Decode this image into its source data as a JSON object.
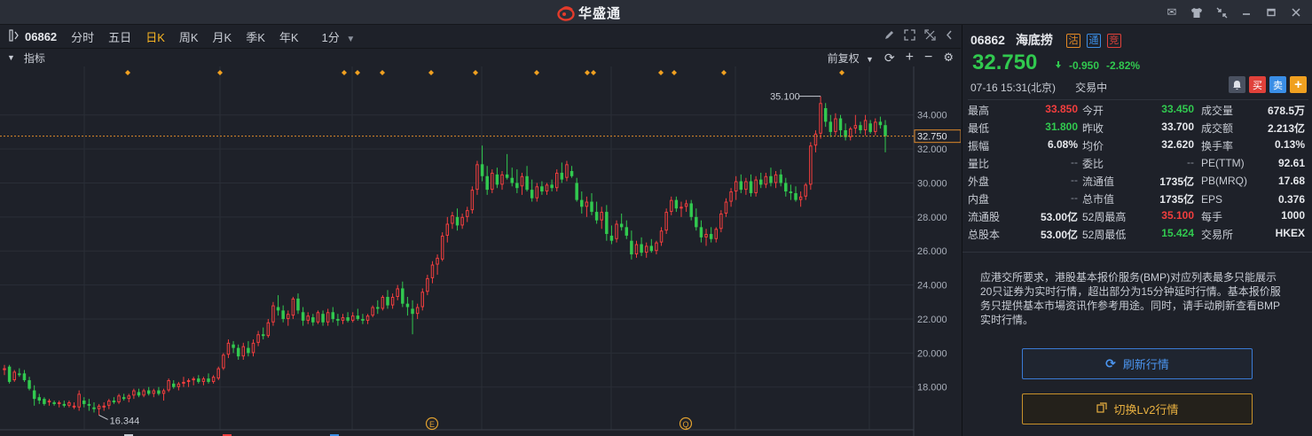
{
  "app": {
    "brand": "华盛通",
    "brand_color": "#e33b2b",
    "window_icons": [
      "mail-icon",
      "shirt-icon",
      "shrink-icon",
      "minimize-icon",
      "maximize-icon",
      "close-icon"
    ]
  },
  "toolbar": {
    "code": "06862",
    "periods": [
      "分时",
      "五日",
      "日K",
      "周K",
      "月K",
      "季K",
      "年K"
    ],
    "active_period": "日K",
    "minute_select": "1分"
  },
  "subbar": {
    "indicator_label": "指标",
    "adjust_label": "前复权"
  },
  "chart_data": {
    "type": "candlestick",
    "y_axis_ticks": [
      "34.000",
      "32.000",
      "30.000",
      "28.000",
      "26.000",
      "24.000",
      "22.000",
      "20.000",
      "18.000"
    ],
    "ylim": [
      15.9,
      35.6
    ],
    "current_price_label": "32.750",
    "current_price": 32.75,
    "high_marker": {
      "label": "35.100",
      "value": 35.1
    },
    "low_marker": {
      "label": "16.344",
      "value": 16.344
    },
    "event_markers": [
      "E",
      "Q"
    ],
    "candles": [
      [
        19.0,
        19.3,
        18.7,
        19.1
      ],
      [
        19.2,
        19.3,
        18.2,
        18.3
      ],
      [
        18.4,
        19.0,
        18.3,
        18.9
      ],
      [
        18.8,
        19.1,
        18.6,
        18.7
      ],
      [
        18.8,
        19.0,
        18.3,
        18.4
      ],
      [
        18.4,
        18.6,
        17.8,
        17.9
      ],
      [
        17.8,
        18.1,
        16.9,
        17.3
      ],
      [
        17.4,
        17.6,
        17.0,
        17.2
      ],
      [
        17.3,
        17.4,
        16.9,
        17.0
      ],
      [
        17.1,
        17.3,
        16.9,
        17.2
      ],
      [
        17.1,
        17.2,
        16.9,
        17.0
      ],
      [
        17.0,
        17.2,
        16.8,
        17.1
      ],
      [
        17.0,
        17.2,
        16.8,
        16.9
      ],
      [
        16.9,
        17.2,
        16.8,
        17.1
      ],
      [
        16.9,
        17.1,
        16.7,
        16.9
      ],
      [
        16.8,
        17.8,
        16.6,
        17.6
      ],
      [
        17.2,
        17.4,
        16.8,
        17.0
      ],
      [
        17.0,
        17.3,
        16.6,
        16.9
      ],
      [
        16.8,
        17.1,
        16.5,
        16.7
      ],
      [
        16.7,
        17.0,
        16.344,
        16.9
      ],
      [
        16.8,
        17.1,
        16.6,
        16.9
      ],
      [
        16.9,
        17.3,
        16.7,
        17.2
      ],
      [
        17.2,
        17.4,
        17.0,
        17.1
      ],
      [
        17.1,
        17.6,
        17.0,
        17.5
      ],
      [
        17.4,
        17.6,
        17.2,
        17.3
      ],
      [
        17.3,
        17.6,
        17.1,
        17.5
      ],
      [
        17.5,
        17.9,
        17.3,
        17.8
      ],
      [
        17.7,
        17.9,
        17.4,
        17.5
      ],
      [
        17.5,
        17.9,
        17.4,
        17.8
      ],
      [
        17.8,
        18.0,
        17.5,
        17.6
      ],
      [
        17.6,
        17.9,
        17.4,
        17.8
      ],
      [
        17.8,
        18.0,
        17.5,
        17.6
      ],
      [
        17.6,
        17.9,
        17.2,
        17.8
      ],
      [
        17.8,
        18.5,
        17.7,
        18.4
      ],
      [
        18.2,
        18.4,
        17.9,
        18.0
      ],
      [
        18.0,
        18.3,
        17.8,
        18.2
      ],
      [
        18.2,
        18.6,
        18.0,
        18.3
      ],
      [
        18.3,
        18.5,
        18.0,
        18.4
      ],
      [
        18.4,
        18.6,
        18.1,
        18.5
      ],
      [
        18.5,
        18.7,
        18.2,
        18.3
      ],
      [
        18.3,
        18.6,
        18.1,
        18.5
      ],
      [
        18.5,
        18.8,
        18.2,
        18.3
      ],
      [
        18.3,
        18.7,
        18.2,
        18.6
      ],
      [
        18.5,
        19.2,
        18.4,
        19.1
      ],
      [
        19.1,
        20.0,
        19.0,
        19.9
      ],
      [
        19.9,
        20.8,
        19.7,
        20.6
      ],
      [
        20.5,
        20.7,
        20.0,
        20.3
      ],
      [
        20.3,
        20.5,
        19.6,
        19.8
      ],
      [
        19.8,
        20.6,
        19.6,
        20.4
      ],
      [
        20.3,
        20.7,
        19.8,
        20.0
      ],
      [
        20.0,
        20.8,
        19.8,
        20.6
      ],
      [
        20.6,
        21.3,
        20.4,
        21.1
      ],
      [
        21.1,
        21.5,
        20.8,
        21.0
      ],
      [
        21.0,
        22.0,
        20.9,
        21.8
      ],
      [
        21.8,
        23.0,
        21.6,
        22.8
      ],
      [
        22.7,
        23.4,
        22.2,
        22.5
      ],
      [
        22.5,
        22.8,
        21.8,
        22.0
      ],
      [
        22.0,
        22.5,
        21.6,
        22.3
      ],
      [
        22.2,
        23.3,
        22.0,
        23.2
      ],
      [
        23.2,
        23.5,
        22.3,
        22.5
      ],
      [
        22.4,
        22.7,
        21.6,
        21.9
      ],
      [
        21.9,
        22.4,
        21.7,
        22.2
      ],
      [
        22.1,
        22.3,
        21.6,
        21.8
      ],
      [
        21.8,
        22.5,
        21.7,
        22.4
      ],
      [
        22.3,
        22.5,
        21.6,
        21.8
      ],
      [
        21.8,
        22.6,
        21.6,
        22.4
      ],
      [
        22.4,
        22.7,
        21.8,
        22.0
      ],
      [
        22.0,
        22.3,
        21.6,
        21.9
      ],
      [
        21.9,
        22.3,
        21.7,
        22.1
      ],
      [
        22.1,
        22.4,
        21.8,
        21.9
      ],
      [
        21.9,
        22.4,
        21.8,
        22.2
      ],
      [
        22.2,
        22.6,
        21.9,
        22.0
      ],
      [
        22.0,
        22.3,
        21.7,
        21.9
      ],
      [
        21.9,
        22.3,
        21.7,
        22.2
      ],
      [
        22.2,
        22.8,
        22.1,
        22.7
      ],
      [
        22.7,
        23.1,
        22.3,
        22.6
      ],
      [
        22.6,
        23.4,
        22.5,
        23.3
      ],
      [
        23.3,
        23.7,
        22.6,
        22.8
      ],
      [
        22.8,
        23.5,
        22.6,
        23.3
      ],
      [
        23.3,
        24.0,
        23.1,
        23.8
      ],
      [
        23.8,
        24.2,
        22.7,
        22.9
      ],
      [
        22.9,
        23.3,
        22.2,
        22.7
      ],
      [
        22.6,
        23.1,
        21.1,
        22.3
      ],
      [
        22.3,
        22.9,
        22.0,
        22.7
      ],
      [
        22.7,
        23.8,
        22.5,
        23.6
      ],
      [
        23.6,
        24.6,
        23.4,
        24.4
      ],
      [
        24.4,
        25.4,
        24.1,
        25.2
      ],
      [
        25.2,
        25.8,
        24.6,
        25.6
      ],
      [
        25.5,
        27.1,
        25.4,
        26.9
      ],
      [
        26.9,
        28.0,
        26.5,
        27.6
      ],
      [
        27.6,
        28.3,
        27.3,
        28.1
      ],
      [
        28.0,
        28.5,
        27.2,
        27.5
      ],
      [
        27.5,
        28.2,
        27.3,
        28.0
      ],
      [
        28.0,
        28.6,
        27.7,
        28.4
      ],
      [
        28.4,
        29.8,
        28.2,
        29.6
      ],
      [
        29.6,
        31.3,
        29.3,
        31.1
      ],
      [
        31.1,
        32.2,
        30.1,
        30.4
      ],
      [
        30.4,
        31.0,
        29.3,
        29.6
      ],
      [
        29.6,
        30.8,
        29.4,
        30.6
      ],
      [
        30.5,
        30.9,
        29.7,
        29.9
      ],
      [
        29.9,
        30.7,
        29.6,
        30.5
      ],
      [
        30.5,
        31.7,
        30.2,
        30.3
      ],
      [
        30.3,
        30.9,
        29.8,
        30.0
      ],
      [
        30.0,
        30.8,
        29.4,
        29.7
      ],
      [
        29.8,
        30.6,
        29.3,
        30.4
      ],
      [
        30.4,
        31.0,
        29.5,
        29.6
      ],
      [
        29.6,
        30.2,
        28.9,
        29.1
      ],
      [
        29.1,
        30.0,
        28.9,
        29.8
      ],
      [
        29.8,
        30.1,
        29.3,
        29.5
      ],
      [
        29.5,
        30.0,
        29.3,
        29.9
      ],
      [
        29.9,
        30.2,
        29.5,
        29.7
      ],
      [
        29.7,
        30.8,
        29.5,
        30.6
      ],
      [
        30.6,
        31.2,
        30.0,
        30.2
      ],
      [
        30.3,
        31.3,
        30.1,
        31.1
      ],
      [
        30.7,
        31.0,
        30.3,
        30.4
      ],
      [
        30.0,
        30.3,
        28.9,
        29.0
      ],
      [
        29.0,
        29.5,
        28.2,
        28.6
      ],
      [
        28.6,
        29.2,
        28.0,
        28.9
      ],
      [
        28.9,
        29.4,
        28.1,
        28.3
      ],
      [
        28.3,
        28.9,
        27.6,
        27.8
      ],
      [
        27.8,
        28.6,
        27.3,
        28.3
      ],
      [
        28.3,
        28.7,
        26.6,
        27.0
      ],
      [
        26.9,
        27.5,
        26.4,
        26.6
      ],
      [
        26.7,
        27.8,
        26.5,
        27.6
      ],
      [
        27.6,
        28.2,
        27.2,
        27.4
      ],
      [
        27.4,
        27.8,
        26.7,
        26.9
      ],
      [
        26.6,
        27.2,
        25.5,
        25.8
      ],
      [
        25.8,
        26.6,
        25.6,
        26.4
      ],
      [
        26.4,
        26.8,
        25.7,
        25.9
      ],
      [
        25.9,
        26.5,
        25.6,
        26.3
      ],
      [
        26.3,
        26.7,
        25.9,
        26.0
      ],
      [
        26.0,
        26.6,
        25.8,
        26.5
      ],
      [
        26.5,
        27.4,
        26.3,
        27.2
      ],
      [
        27.2,
        28.5,
        27.0,
        28.3
      ],
      [
        28.3,
        29.2,
        28.1,
        29.0
      ],
      [
        29.0,
        29.2,
        28.3,
        28.5
      ],
      [
        28.5,
        28.9,
        28.0,
        28.6
      ],
      [
        28.6,
        29.0,
        28.3,
        28.8
      ],
      [
        28.8,
        29.0,
        27.8,
        28.0
      ],
      [
        28.0,
        28.5,
        27.2,
        27.4
      ],
      [
        27.4,
        27.8,
        26.5,
        26.8
      ],
      [
        26.8,
        27.3,
        26.3,
        27.0
      ],
      [
        27.0,
        27.4,
        26.5,
        26.7
      ],
      [
        26.7,
        27.4,
        26.5,
        27.3
      ],
      [
        27.3,
        28.4,
        27.1,
        28.2
      ],
      [
        28.2,
        29.1,
        28.0,
        28.9
      ],
      [
        28.9,
        29.7,
        28.6,
        29.5
      ],
      [
        29.5,
        30.4,
        29.0,
        30.1
      ],
      [
        30.1,
        30.5,
        29.4,
        29.6
      ],
      [
        29.6,
        30.3,
        29.3,
        30.1
      ],
      [
        30.1,
        30.5,
        29.2,
        29.4
      ],
      [
        29.4,
        30.4,
        29.2,
        30.2
      ],
      [
        30.2,
        30.6,
        29.7,
        29.9
      ],
      [
        29.9,
        30.6,
        29.7,
        30.4
      ],
      [
        30.4,
        30.9,
        29.8,
        30.0
      ],
      [
        30.0,
        30.7,
        29.7,
        30.5
      ],
      [
        30.5,
        30.8,
        29.8,
        30.0
      ],
      [
        30.0,
        30.3,
        29.2,
        29.5
      ],
      [
        29.5,
        29.9,
        29.0,
        29.4
      ],
      [
        29.4,
        29.8,
        28.9,
        29.0
      ],
      [
        29.0,
        29.5,
        28.6,
        29.2
      ],
      [
        29.2,
        30.0,
        29.0,
        29.9
      ],
      [
        29.9,
        32.4,
        29.6,
        32.2
      ],
      [
        32.2,
        33.1,
        31.8,
        32.9
      ],
      [
        32.9,
        35.1,
        32.6,
        34.7
      ],
      [
        34.4,
        34.7,
        33.3,
        33.6
      ],
      [
        33.6,
        34.0,
        32.7,
        33.0
      ],
      [
        33.0,
        34.1,
        32.8,
        33.8
      ],
      [
        33.8,
        34.0,
        32.7,
        33.1
      ],
      [
        33.1,
        33.5,
        32.5,
        32.7
      ],
      [
        32.7,
        33.3,
        32.5,
        33.2
      ],
      [
        33.2,
        34.0,
        32.9,
        33.4
      ],
      [
        33.4,
        33.6,
        32.9,
        33.1
      ],
      [
        33.1,
        34.0,
        32.8,
        33.7
      ],
      [
        33.5,
        33.7,
        32.9,
        33.0
      ],
      [
        33.0,
        33.8,
        32.8,
        33.6
      ],
      [
        33.6,
        33.9,
        33.2,
        33.4
      ],
      [
        33.4,
        33.7,
        31.8,
        32.75
      ]
    ]
  },
  "quote": {
    "code": "06862",
    "name": "海底捞",
    "tags": [
      {
        "label": "沽",
        "color": "#e58a24"
      },
      {
        "label": "通",
        "color": "#3a8ee6"
      },
      {
        "label": "竞",
        "color": "#e0413a"
      }
    ],
    "price": "32.750",
    "change": "-0.950",
    "change_pct": "-2.82%",
    "datetime": "07-16  15:31(北京)",
    "status": "交易中",
    "trade_buttons": [
      {
        "label": "▲",
        "name": "alert-bell-icon",
        "color": "#4a5160"
      },
      {
        "label": "买",
        "name": "buy-button",
        "color": "#e0413a"
      },
      {
        "label": "卖",
        "name": "sell-button",
        "color": "#3a8ee6"
      },
      {
        "label": "+",
        "name": "add-watchlist-button",
        "color": "#f0a020"
      }
    ]
  },
  "stats": [
    [
      {
        "l": "最高",
        "v": "33.850",
        "c": "red"
      },
      {
        "l": "今开",
        "v": "33.450",
        "c": "green"
      },
      {
        "l": "成交量",
        "v": "678.5万",
        "c": ""
      }
    ],
    [
      {
        "l": "最低",
        "v": "31.800",
        "c": "green"
      },
      {
        "l": "昨收",
        "v": "33.700",
        "c": ""
      },
      {
        "l": "成交额",
        "v": "2.213亿",
        "c": ""
      }
    ],
    [
      {
        "l": "振幅",
        "v": "6.08%",
        "c": ""
      },
      {
        "l": "均价",
        "v": "32.620",
        "c": ""
      },
      {
        "l": "换手率",
        "v": "0.13%",
        "c": ""
      }
    ],
    [
      {
        "l": "量比",
        "v": "--",
        "c": "dash"
      },
      {
        "l": "委比",
        "v": "--",
        "c": "dash"
      },
      {
        "l": "PE(TTM)",
        "v": "92.61",
        "c": ""
      }
    ],
    [
      {
        "l": "外盘",
        "v": "--",
        "c": "dash"
      },
      {
        "l": "流通值",
        "v": "1735亿",
        "c": ""
      },
      {
        "l": "PB(MRQ)",
        "v": "17.68",
        "c": ""
      }
    ],
    [
      {
        "l": "内盘",
        "v": "--",
        "c": "dash"
      },
      {
        "l": "总市值",
        "v": "1735亿",
        "c": ""
      },
      {
        "l": "EPS",
        "v": "0.376",
        "c": ""
      }
    ],
    [
      {
        "l": "流通股",
        "v": "53.00亿",
        "c": ""
      },
      {
        "l": "52周最高",
        "v": "35.100",
        "c": "red"
      },
      {
        "l": "每手",
        "v": "1000",
        "c": ""
      }
    ],
    [
      {
        "l": "总股本",
        "v": "53.00亿",
        "c": ""
      },
      {
        "l": "52周最低",
        "v": "15.424",
        "c": "green"
      },
      {
        "l": "交易所",
        "v": "HKEX",
        "c": ""
      }
    ]
  ],
  "notice": "应港交所要求，港股基本报价服务(BMP)对应列表最多只能展示20只证券为实时行情，超出部分为15分钟延时行情。基本报价服务只提供基本市場资讯作参考用途。同时，请手动刷新查看BMP实时行情。",
  "buttons": {
    "refresh": "刷新行情",
    "lv2": "切换Lv2行情"
  }
}
